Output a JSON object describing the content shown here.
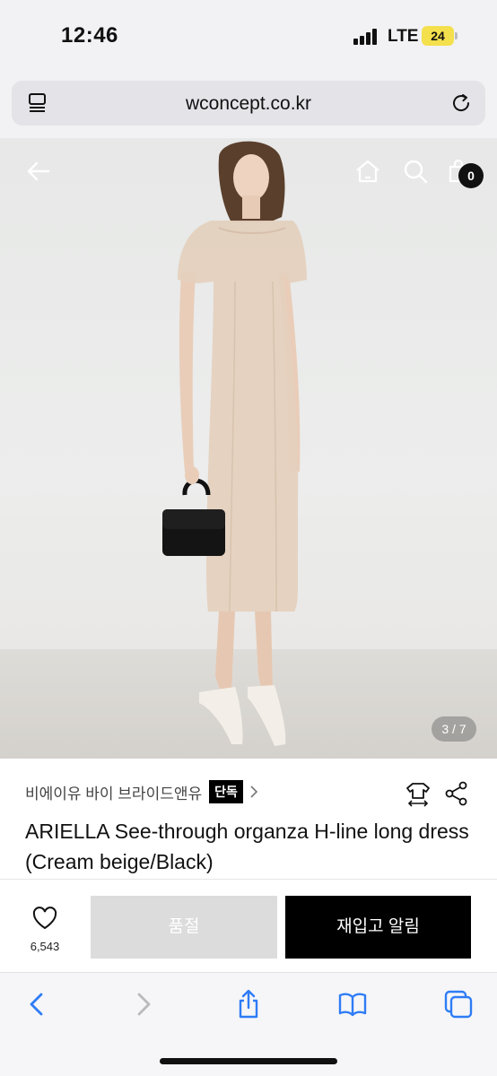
{
  "status_bar": {
    "time": "12:46",
    "network": "LTE",
    "battery": "24"
  },
  "browser": {
    "url": "wconcept.co.kr"
  },
  "gallery": {
    "counter": "3 / 7",
    "cart_count": "0"
  },
  "product": {
    "brand": "비에이유 바이 브라이드앤유",
    "exclusive_badge": "단독",
    "title": "ARIELLA See-through organza H-line long dress (Cream beige/Black)"
  },
  "actions": {
    "wish_count": "6,543",
    "sold_out_label": "품절",
    "restock_alert_label": "재입고 알림"
  },
  "colors": {
    "sold_out_bg": "#dcdcdc",
    "primary_btn": "#000000",
    "battery": "#f4e04d"
  },
  "icons": [
    "tabs-icon",
    "reload-icon",
    "back-arrow-icon",
    "home-icon",
    "search-icon",
    "cart-icon",
    "size-guide-icon",
    "share-icon",
    "heart-icon",
    "browser-back-icon",
    "browser-forward-icon",
    "share-sheet-icon",
    "bookmarks-icon",
    "tabs-overview-icon"
  ]
}
